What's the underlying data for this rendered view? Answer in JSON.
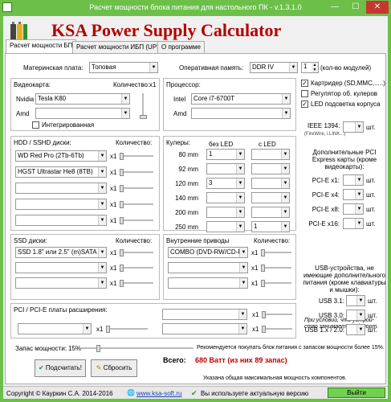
{
  "window": {
    "title": "Расчет мощности блока питания для настольного ПК - v.1.3.1.0",
    "minimize": "—",
    "maximize": "☐",
    "close": "✕"
  },
  "header": {
    "brand": "KSA Power Supply Calculator"
  },
  "tabs": [
    "Расчет мощности БП",
    "Расчет мощности ИБП (UPS)",
    "О программе"
  ],
  "motherboard": {
    "label": "Материнская плата:",
    "value": "Топовая"
  },
  "ram": {
    "label": "Оперативная память:",
    "type": "DDR IV",
    "count": "1",
    "count_label": "(кол-во модулей)"
  },
  "gpu": {
    "title": "Видеокарта:",
    "qty_label": "Количество:",
    "qty_value": "x1",
    "nvidia_label": "Nvidia",
    "nvidia_value": "Tesla K80",
    "amd_label": "Amd",
    "amd_value": "",
    "integrated_label": "Интегрированная"
  },
  "cpu": {
    "title": "Процессор:",
    "intel_label": "Intel",
    "intel_value": "Core i7-6700T",
    "amd_label": "Amd",
    "amd_value": ""
  },
  "options": [
    {
      "label": "Картридер (SD,MMC,.....)",
      "checked": true
    },
    {
      "label": "Регулятор об. кулеров",
      "checked": false
    },
    {
      "label": "LED подсветка корпуса",
      "checked": true
    }
  ],
  "ieee": {
    "label": "IEEE 1394:",
    "sub": "(FireWire, i.LINK...)",
    "unit": "шт."
  },
  "hdd": {
    "title": "HDD / SSHD диски:",
    "qty_label": "Количество:",
    "rows": [
      {
        "value": "WD Red Pro (2Tb-6Tb)",
        "qty": "x1"
      },
      {
        "value": "HGST Ultrastar He8 (8TB)",
        "qty": "x1"
      },
      {
        "value": "",
        "qty": "x1"
      },
      {
        "value": "",
        "qty": "x1"
      },
      {
        "value": "",
        "qty": "x1"
      }
    ]
  },
  "coolers": {
    "title": "Кулеры:",
    "no_led": "без LED",
    "led": "с LED",
    "rows": [
      {
        "size": "80 mm",
        "no_led": "1",
        "led": ""
      },
      {
        "size": "92 mm",
        "no_led": "",
        "led": ""
      },
      {
        "size": "120 mm",
        "no_led": "3",
        "led": ""
      },
      {
        "size": "140 mm",
        "no_led": "",
        "led": ""
      },
      {
        "size": "200 mm",
        "no_led": "",
        "led": ""
      },
      {
        "size": "250 mm",
        "no_led": "",
        "led": "1"
      }
    ]
  },
  "pci_cards": {
    "title": "Дополнительные PCI Express карты (кроме видеокарты):",
    "rows": [
      {
        "label": "PCI-E x1:",
        "unit": "шт."
      },
      {
        "label": "PCI-E x4:",
        "unit": "шт."
      },
      {
        "label": "PCI-E x8:",
        "unit": "шт."
      },
      {
        "label": "PCI-E x16:",
        "unit": "шт."
      }
    ]
  },
  "ssd": {
    "title": "SSD диски:",
    "qty_label": "Количество:",
    "rows": [
      {
        "value": "SSD 1.8\" или 2.5\" (m)SATA",
        "qty": "x1"
      },
      {
        "value": "",
        "qty": "x1"
      },
      {
        "value": "",
        "qty": "x1"
      }
    ]
  },
  "drives": {
    "title": "Внутренние приводы",
    "qty_label": "Количество:",
    "rows": [
      {
        "value": "COMBO (DVD-RW/CD-R",
        "qty": "x1"
      },
      {
        "value": "",
        "qty": "x1"
      },
      {
        "value": "",
        "qty": "x1"
      }
    ]
  },
  "usb": {
    "title": "USB-устройства, не имеющие дополнительного питания (кроме клавиатуры и мышки):",
    "rows": [
      {
        "label": "USB 3.1:",
        "unit": "шт."
      },
      {
        "label": "USB 3.0:",
        "unit": "шт."
      },
      {
        "label": "USB 1.x / 2.0:",
        "unit": "шт."
      }
    ],
    "note": "При условии, что устрой-ство занимает 1 usb порт."
  },
  "pci": {
    "title": "PCI / PCI-E платы расширения:",
    "qty": "x1"
  },
  "margin": {
    "label": "Запас мощности:",
    "value": "15%",
    "fraction": 0.15,
    "note": "Рекомендуется покупать блок питания с запасом мощности более 15%."
  },
  "result": {
    "total_label": "Всего:",
    "total_value": "680 Ватт (из них 89 запас)",
    "note": "Указана общая максимальная мощность компонентов."
  },
  "buttons": {
    "calculate": "Подсчитать!",
    "reset": "Сбросить"
  },
  "status": {
    "copyright": "Copyright © Кауркин С.А. 2014-2016",
    "site": "www.ksa-soft.ru",
    "update_msg": "Вы используете актуальную версию",
    "exit": "Выйти"
  }
}
